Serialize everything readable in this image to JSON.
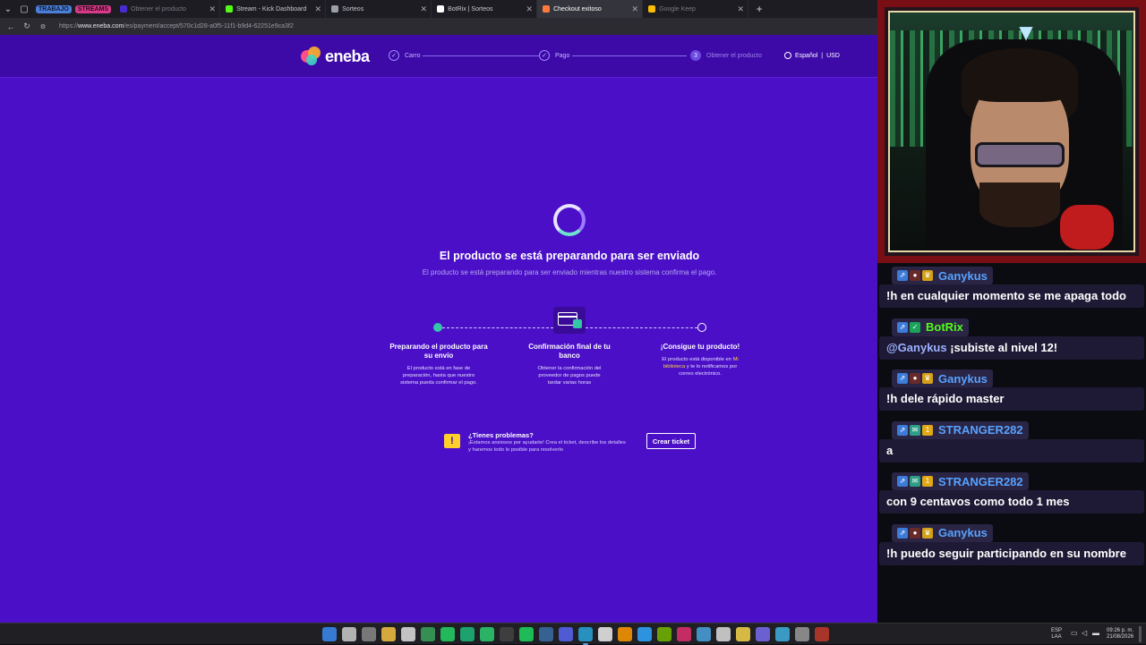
{
  "browser": {
    "groups": [
      {
        "label": "TRABAJO",
        "bg": "#4a7fd8",
        "fg": "#0e1a33"
      },
      {
        "label": "STREAMS",
        "bg": "#d83a8a",
        "fg": "#2a0a18"
      }
    ],
    "tabs": [
      {
        "title": "Obtener el producto",
        "color": "#4a2bd1",
        "state": "dim"
      },
      {
        "title": "Stream - Kick Dashboard",
        "color": "#53fc18",
        "state": "normal"
      },
      {
        "title": "Sorteos",
        "color": "#9aa0a6",
        "state": "normal"
      },
      {
        "title": "BotRix | Sorteos",
        "color": "#ffffff",
        "state": "normal"
      },
      {
        "title": "Checkout exitoso",
        "color": "#ff7a3c",
        "state": "active"
      },
      {
        "title": "Google Keep",
        "color": "#fbbc04",
        "state": "dim"
      }
    ],
    "url_prefix": "https://",
    "url_host": "www.eneba.com",
    "url_path": "/es/payment/accept/570c1d28-a0f5-11f1-b9d4-62251e9ca3f2"
  },
  "eneba": {
    "logo_text": "eneba",
    "steps": [
      {
        "label": "Carro",
        "marker": "✓"
      },
      {
        "label": "Pago",
        "marker": "✓"
      },
      {
        "label": "Obtener el producto",
        "marker": "3"
      }
    ],
    "language": "Español",
    "separator": "|",
    "currency": "USD",
    "title": "El producto se está preparando para ser enviado",
    "subtitle": "El producto se está preparando para ser enviado mientras nuestro sistema confirma el pago.",
    "progress": {
      "col1_title": "Preparando el producto para su envío",
      "col1_text": "El producto está en fase de preparación, hasta que nuestro sistema pueda confirmar el pago.",
      "col2_title": "Confirmación final de tu banco",
      "col2_text": "Obtener la confirmación del proveedor de pagos puede tardar varias horas",
      "col3_title": "¡Consigue tu producto!",
      "col3_text_a": "El producto está disponible en ",
      "col3_link": "Mi biblioteca",
      "col3_text_b": " y te lo notificamos por correo electrónico."
    },
    "help": {
      "icon": "!",
      "title": "¿Tienes problemas?",
      "text": "¡Estamos ansiosos por ayudarte! Crea el ticket, describe los detalles y haremos todo lo posible para resolverlo",
      "button": "Crear ticket"
    }
  },
  "chat": {
    "messages": [
      {
        "user": "Ganykus",
        "user_color": "#57a3ff",
        "badges": [
          "kick",
          "sub",
          "crown"
        ],
        "text": "!h en cualquier momento se me apaga todo",
        "mention": ""
      },
      {
        "user": "BotRix",
        "user_color": "#53fc18",
        "badges": [
          "kick",
          "check"
        ],
        "mention": "@Ganykus",
        "text": " ¡subiste al nivel 12!"
      },
      {
        "user": "Ganykus",
        "user_color": "#57a3ff",
        "badges": [
          "kick",
          "sub",
          "crown"
        ],
        "text": "!h dele rápido master",
        "mention": ""
      },
      {
        "user": "STRANGER282",
        "user_color": "#57a3ff",
        "badges": [
          "kick",
          "mail",
          "coin"
        ],
        "text": "a",
        "mention": ""
      },
      {
        "user": "STRANGER282",
        "user_color": "#57a3ff",
        "badges": [
          "kick",
          "mail",
          "coin"
        ],
        "text": "con 9 centavos como todo 1 mes",
        "mention": ""
      },
      {
        "user": "Ganykus",
        "user_color": "#57a3ff",
        "badges": [
          "kick",
          "sub",
          "crown"
        ],
        "text": "!h puedo seguir participando en su nombre",
        "mention": ""
      }
    ]
  },
  "taskbar": {
    "lang_top": "ESP",
    "lang_bottom": "LAA",
    "time": "09:26 p. m.",
    "date": "21/08/2026"
  }
}
